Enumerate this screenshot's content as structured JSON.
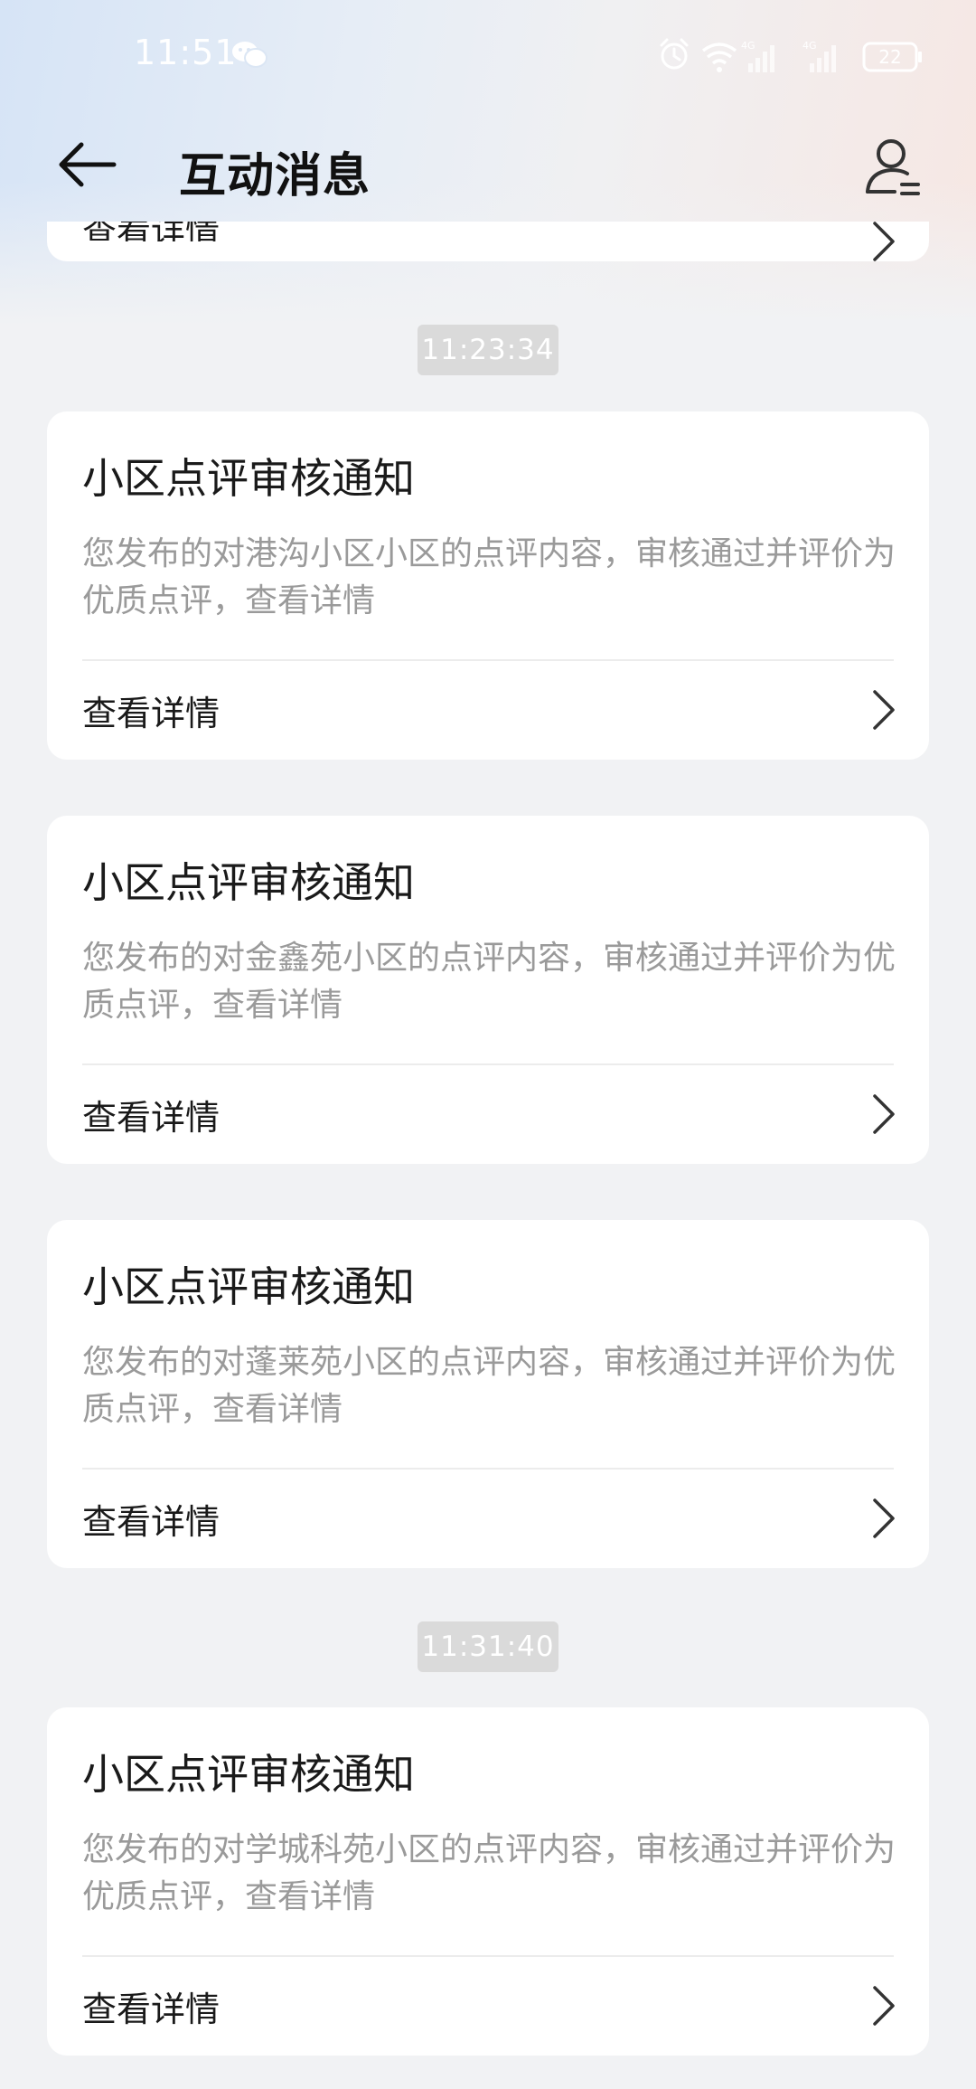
{
  "status_bar": {
    "time": "11:51",
    "battery": "22",
    "network_label": "4G"
  },
  "header": {
    "title": "互动消息"
  },
  "partial_card": {
    "detail_label": "查看详情"
  },
  "timestamps": [
    "11:23:34",
    "11:31:40"
  ],
  "messages": [
    {
      "title": "小区点评审核通知",
      "body": "您发布的对港沟小区小区的点评内容，审核通过并评价为优质点评，查看详情",
      "detail_label": "查看详情"
    },
    {
      "title": "小区点评审核通知",
      "body": "您发布的对金鑫苑小区的点评内容，审核通过并评价为优质点评，查看详情",
      "detail_label": "查看详情"
    },
    {
      "title": "小区点评审核通知",
      "body": "您发布的对蓬莱苑小区的点评内容，审核通过并评价为优质点评，查看详情",
      "detail_label": "查看详情"
    },
    {
      "title": "小区点评审核通知",
      "body": "您发布的对学城科苑小区的点评内容，审核通过并评价为优质点评，查看详情",
      "detail_label": "查看详情"
    }
  ]
}
